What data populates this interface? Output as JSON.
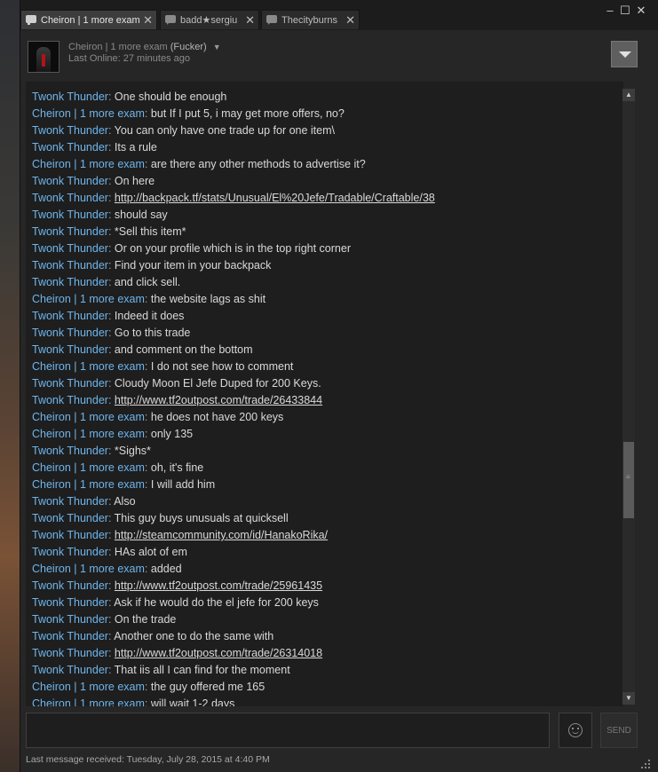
{
  "tabs": [
    {
      "label": "Cheiron | 1 more exam",
      "active": true
    },
    {
      "label": "badd★sergiu",
      "active": false
    },
    {
      "label": "Thecityburns",
      "active": false
    }
  ],
  "window_controls": {
    "minimize": "–",
    "maximize": "☐",
    "close": "✕"
  },
  "header": {
    "name": "Cheiron | 1 more exam",
    "nickname": "(Fucker)",
    "status": "Last Online: 27 minutes ago"
  },
  "messages": [
    {
      "sender": "Twonk Thunder",
      "text": "One should be enough",
      "link": false,
      "self": false
    },
    {
      "sender": "Cheiron | 1 more exam",
      "text": "but If I put 5, i may get more offers, no?",
      "link": false,
      "self": true
    },
    {
      "sender": "Twonk Thunder",
      "text": "You can only have one trade up for one item\\",
      "link": false,
      "self": false
    },
    {
      "sender": "Twonk Thunder",
      "text": "Its a rule",
      "link": false,
      "self": false
    },
    {
      "sender": "Cheiron | 1 more exam",
      "text": "are there any other methods to advertise it?",
      "link": false,
      "self": true
    },
    {
      "sender": "Twonk Thunder",
      "text": "On here",
      "link": false,
      "self": false
    },
    {
      "sender": "Twonk Thunder",
      "text": "http://backpack.tf/stats/Unusual/El%20Jefe/Tradable/Craftable/38",
      "link": true,
      "self": false
    },
    {
      "sender": "Twonk Thunder",
      "text": "should say",
      "link": false,
      "self": false
    },
    {
      "sender": "Twonk Thunder",
      "text": "*Sell this item*",
      "link": false,
      "self": false
    },
    {
      "sender": "Twonk Thunder",
      "text": "Or on your profile which is in the top right corner",
      "link": false,
      "self": false
    },
    {
      "sender": "Twonk Thunder",
      "text": "Find your item in your backpack",
      "link": false,
      "self": false
    },
    {
      "sender": "Twonk Thunder",
      "text": "and click sell.",
      "link": false,
      "self": false
    },
    {
      "sender": "Cheiron | 1 more exam",
      "text": "the website lags as shit",
      "link": false,
      "self": true
    },
    {
      "sender": "Twonk Thunder",
      "text": "Indeed it does",
      "link": false,
      "self": false
    },
    {
      "sender": "Twonk Thunder",
      "text": "Go to this trade",
      "link": false,
      "self": false
    },
    {
      "sender": "Twonk Thunder",
      "text": "and comment on the bottom",
      "link": false,
      "self": false
    },
    {
      "sender": "Cheiron | 1 more exam",
      "text": "I do not see how to comment",
      "link": false,
      "self": true
    },
    {
      "sender": "Twonk Thunder",
      "text": "Cloudy Moon El Jefe Duped for 200 Keys.",
      "link": false,
      "self": false
    },
    {
      "sender": "Twonk Thunder",
      "text": "http://www.tf2outpost.com/trade/26433844",
      "link": true,
      "self": false
    },
    {
      "sender": "Cheiron | 1 more exam",
      "text": "he does not have 200 keys",
      "link": false,
      "self": true
    },
    {
      "sender": "Cheiron | 1 more exam",
      "text": "only 135",
      "link": false,
      "self": true
    },
    {
      "sender": "Twonk Thunder",
      "text": "*Sighs*",
      "link": false,
      "self": false
    },
    {
      "sender": "Cheiron | 1 more exam",
      "text": "oh, it's fine",
      "link": false,
      "self": true
    },
    {
      "sender": "Cheiron | 1 more exam",
      "text": "I will add him",
      "link": false,
      "self": true
    },
    {
      "sender": "Twonk Thunder",
      "text": "Also",
      "link": false,
      "self": false
    },
    {
      "sender": "Twonk Thunder",
      "text": "This guy buys unusuals at quicksell",
      "link": false,
      "self": false
    },
    {
      "sender": "Twonk Thunder",
      "text": "http://steamcommunity.com/id/HanakoRika/",
      "link": true,
      "self": false
    },
    {
      "sender": "Twonk Thunder",
      "text": "HAs alot of em",
      "link": false,
      "self": false
    },
    {
      "sender": "Cheiron | 1 more exam",
      "text": "added",
      "link": false,
      "self": true
    },
    {
      "sender": "Twonk Thunder",
      "text": "http://www.tf2outpost.com/trade/25961435",
      "link": true,
      "self": false
    },
    {
      "sender": "Twonk Thunder",
      "text": "Ask if he would do the el jefe for 200 keys",
      "link": false,
      "self": false
    },
    {
      "sender": "Twonk Thunder",
      "text": "On the trade",
      "link": false,
      "self": false
    },
    {
      "sender": "Twonk Thunder",
      "text": "Another one to do the same with",
      "link": false,
      "self": false
    },
    {
      "sender": "Twonk Thunder",
      "text": "http://www.tf2outpost.com/trade/26314018",
      "link": true,
      "self": false
    },
    {
      "sender": "Twonk Thunder",
      "text": "That iis all I can find for the moment",
      "link": false,
      "self": false
    },
    {
      "sender": "Cheiron | 1 more exam",
      "text": "the guy offered me 165",
      "link": false,
      "self": true
    },
    {
      "sender": "Cheiron | 1 more exam",
      "text": "will wait 1-2 days",
      "link": false,
      "self": true
    }
  ],
  "input": {
    "placeholder": "",
    "value": ""
  },
  "send_label": "SEND",
  "footer": "Last message received: Tuesday, July 28, 2015 at 4:40 PM",
  "colors": {
    "sender": "#6fb5ec",
    "message": "#d9d9d9",
    "background": "#1e1e1e"
  }
}
